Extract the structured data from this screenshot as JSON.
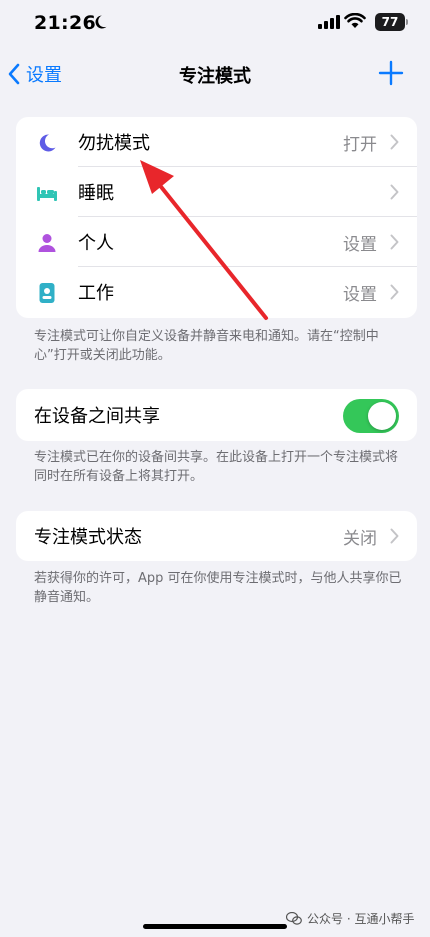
{
  "status_bar": {
    "time": "21:26",
    "battery": "77"
  },
  "nav": {
    "back_label": "设置",
    "title": "专注模式"
  },
  "focus_modes": [
    {
      "label": "勿扰模式",
      "value": "打开",
      "icon": "moon-icon",
      "color": "#5e5ce6"
    },
    {
      "label": "睡眠",
      "value": "",
      "icon": "bed-icon",
      "color": "#30c5b5"
    },
    {
      "label": "个人",
      "value": "设置",
      "icon": "person-icon",
      "color": "#af52de"
    },
    {
      "label": "工作",
      "value": "设置",
      "icon": "id-badge-icon",
      "color": "#30b0c7"
    }
  ],
  "focus_note": "专注模式可让你自定义设备并静音来电和通知。请在“控制中心”打开或关闭此功能。",
  "share_across_devices": {
    "label": "在设备之间共享",
    "enabled": true
  },
  "share_note": "专注模式已在你的设备间共享。在此设备上打开一个专注模式将同时在所有设备上将其打开。",
  "focus_status": {
    "label": "专注模式状态",
    "value": "关闭"
  },
  "status_note": "若获得你的许可，App 可在你使用专注模式时，与他人共享你已静音通知。",
  "watermark": "公众号 · 互通小帮手",
  "colors": {
    "accent": "#0a7aff",
    "toggle_on": "#34c759",
    "arrow": "#e8262b"
  }
}
